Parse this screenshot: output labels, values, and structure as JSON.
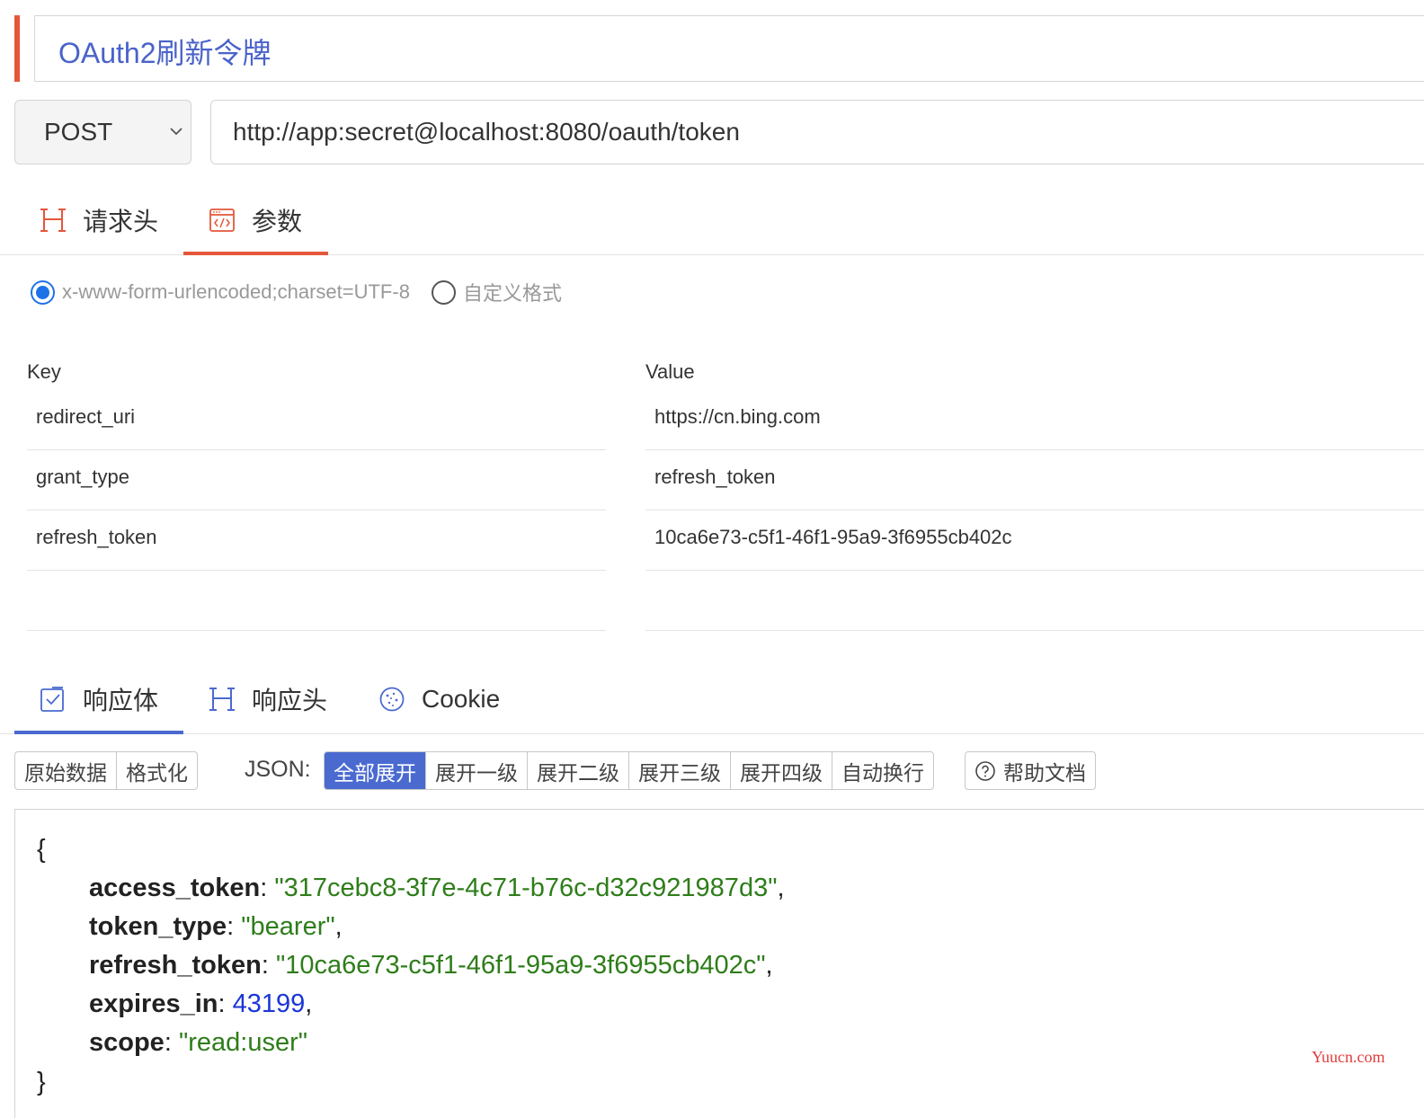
{
  "request": {
    "title": "OAuth2刷新令牌",
    "method": "POST",
    "url": "http://app:secret@localhost:8080/oauth/token"
  },
  "request_tabs": [
    {
      "label": "请求头",
      "icon": "header-h-icon"
    },
    {
      "label": "参数",
      "icon": "code-window-icon",
      "active": true
    }
  ],
  "body_format": {
    "options": [
      {
        "label": "x-www-form-urlencoded;charset=UTF-8",
        "selected": true
      },
      {
        "label": "自定义格式",
        "selected": false
      }
    ]
  },
  "params": {
    "key_header": "Key",
    "value_header": "Value",
    "rows": [
      {
        "key": "redirect_uri",
        "value": "https://cn.bing.com"
      },
      {
        "key": "grant_type",
        "value": "refresh_token"
      },
      {
        "key": "refresh_token",
        "value": "10ca6e73-c5f1-46f1-95a9-3f6955cb402c"
      },
      {
        "key": "",
        "value": ""
      }
    ]
  },
  "response_tabs": [
    {
      "label": "响应体",
      "icon": "checkbox-icon",
      "active": true
    },
    {
      "label": "响应头",
      "icon": "header-h-icon"
    },
    {
      "label": "Cookie",
      "icon": "cookie-icon"
    }
  ],
  "toolbar": {
    "view_buttons": [
      "原始数据",
      "格式化"
    ],
    "json_label": "JSON:",
    "expand_buttons": [
      "全部展开",
      "展开一级",
      "展开二级",
      "展开三级",
      "展开四级",
      "自动换行"
    ],
    "active_expand": "全部展开",
    "help_label": "帮助文档"
  },
  "response_json": {
    "open": "{",
    "close": "}",
    "entries": [
      {
        "key": "access_token",
        "value": "\"317cebc8-3f7e-4c71-b76c-d32c921987d3\"",
        "type": "string",
        "trail": ","
      },
      {
        "key": "token_type",
        "value": "\"bearer\"",
        "type": "string",
        "trail": ","
      },
      {
        "key": "refresh_token",
        "value": "\"10ca6e73-c5f1-46f1-95a9-3f6955cb402c\"",
        "type": "string",
        "trail": ","
      },
      {
        "key": "expires_in",
        "value": "43199",
        "type": "number",
        "trail": ","
      },
      {
        "key": "scope",
        "value": "\"read:user\"",
        "type": "string",
        "trail": ""
      }
    ]
  },
  "colors": {
    "accent_red": "#e4573a",
    "accent_blue": "#4a6ad0",
    "json_string": "#2e7d1a",
    "json_number": "#1a36d8"
  },
  "watermark": "Yuucn.com"
}
